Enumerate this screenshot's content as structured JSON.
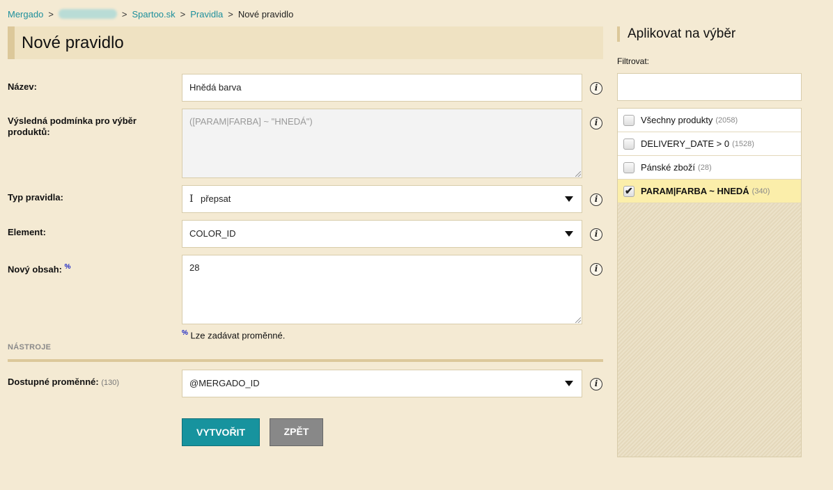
{
  "breadcrumb": {
    "home": "Mergado",
    "sep": ">",
    "shop": "Spartoo.sk",
    "rules": "Pravidla",
    "current": "Nové pravidlo"
  },
  "page_title": "Nové pravidlo",
  "form": {
    "name": {
      "label": "Název:",
      "value": "Hnědá barva"
    },
    "condition": {
      "label": "Výsledná podmínka pro výběr produktů:",
      "value": "([PARAM|FARBA] ~ \"HNEDÁ\")"
    },
    "rule_type": {
      "label": "Typ pravidla:",
      "value": "přepsat"
    },
    "element": {
      "label": "Element:",
      "value": "COLOR_ID"
    },
    "new_content": {
      "label": "Nový obsah:",
      "percent": "%",
      "value": "28"
    },
    "hint": {
      "percent": "%",
      "text": " Lze zadávat proměnné."
    }
  },
  "tools": {
    "heading": "NÁSTROJE",
    "variables": {
      "label": "Dostupné proměnné:",
      "count": "(130)",
      "value": "@MERGADO_ID"
    }
  },
  "buttons": {
    "create": "VYTVOŘIT",
    "back": "ZPĚT"
  },
  "info_glyph": "i",
  "aside": {
    "title": "Aplikovat na výběr",
    "filter_label": "Filtrovat:",
    "filter_value": "",
    "items": [
      {
        "label": "Všechny produkty",
        "count": "(2058)",
        "checked": false
      },
      {
        "label": "DELIVERY_DATE > 0",
        "count": "(1528)",
        "checked": false
      },
      {
        "label": "Pánské zboží",
        "count": "(28)",
        "checked": false
      },
      {
        "label": "PARAM|FARBA ~ HNEDÁ",
        "count": "(340)",
        "checked": true
      }
    ]
  },
  "colors": {
    "background": "#f4ead3",
    "accent": "#17939e",
    "link": "#1d8f9c",
    "selected_row": "#fbeeaa"
  },
  "icons": {
    "info": "info-icon",
    "dropdown": "chevron-down-icon",
    "text_cursor": "text-cursor-icon"
  }
}
